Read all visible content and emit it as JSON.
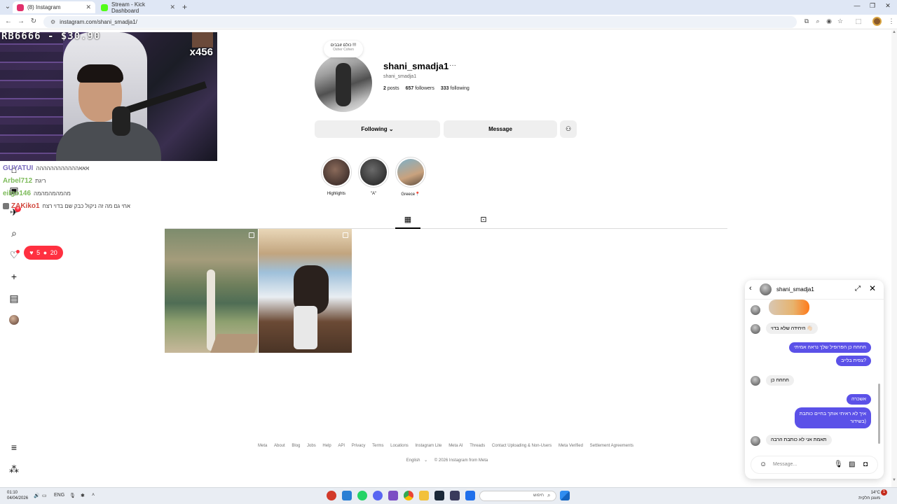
{
  "browser": {
    "tabs": [
      {
        "title": "(8) Instagram",
        "active": true,
        "favicon_color": "#e1306c"
      },
      {
        "title": "Stream - Kick Dashboard",
        "active": false,
        "favicon_color": "#53fc18"
      }
    ],
    "url": "instagram.com/shani_smadja1/"
  },
  "stream_overlay": {
    "donation_text": "RB6666 - $30.90",
    "x_count": "x456",
    "chat": [
      {
        "user": "GUYATUI",
        "text": "אאאהההההההההההה",
        "user_color": "#7a6bbd"
      },
      {
        "user": "Arbel712",
        "text": "ריגת",
        "user_color": "#7dbb5a"
      },
      {
        "user": "eilgo146",
        "text": "מהמהמהמהמה",
        "user_color": "#7dbb5a"
      },
      {
        "user": "ZAKiko1",
        "text": "אחי גם מה זה ניקול כבק שם בדוי רצח",
        "user_color": "#d0463c"
      }
    ]
  },
  "ig_nav": {
    "notif_count": "8",
    "likes_count": "5",
    "followers_count": "20"
  },
  "profile": {
    "note_text": "כולם זובבים !!!",
    "note_sub": "Osher Cohen",
    "username": "shani_smadja1",
    "fullname": "shani_smadja1",
    "posts": "2",
    "posts_label": "posts",
    "followers": "657",
    "followers_label": "followers",
    "following": "333",
    "following_label": "following",
    "following_button": "Following",
    "message_button": "Message",
    "highlights": [
      {
        "label": "Highlights"
      },
      {
        "label": "\"A\""
      },
      {
        "label": "Greece📍"
      }
    ]
  },
  "footer": {
    "links": [
      "Meta",
      "About",
      "Blog",
      "Jobs",
      "Help",
      "API",
      "Privacy",
      "Terms",
      "Locations",
      "Instagram Lite",
      "Meta AI",
      "Threads",
      "Contact Uploading & Non-Users",
      "Meta Verified",
      "Settlement Agreements"
    ],
    "language": "English",
    "copyright": "© 2026 Instagram from Meta"
  },
  "dm": {
    "name": "shani_smadja1",
    "placeholder": "Message...",
    "messages": [
      {
        "dir": "in",
        "text": "היחידה שלא בדוי 👋🏻"
      },
      {
        "dir": "out",
        "text": "חחחח כן הפרופיל שלך נראה אמיתי"
      },
      {
        "dir": "out",
        "text": "צפית בלייב?"
      },
      {
        "dir": "in",
        "text": "חחחח כן"
      },
      {
        "dir": "out",
        "text": "אשכרה"
      },
      {
        "dir": "out",
        "text": "איך לא ראיתי אותך בחיים כותבת"
      },
      {
        "dir": "out",
        "text": "בשידור)"
      },
      {
        "dir": "in",
        "text": "תאמת אני לא כותבת הרבה"
      }
    ]
  },
  "taskbar": {
    "time": "01:10",
    "date": "04/04/2026",
    "lang": "ENG",
    "search_placeholder": "חיפוש",
    "temp": "14°C",
    "weather": "מעונן חלקית",
    "notif": "1"
  }
}
